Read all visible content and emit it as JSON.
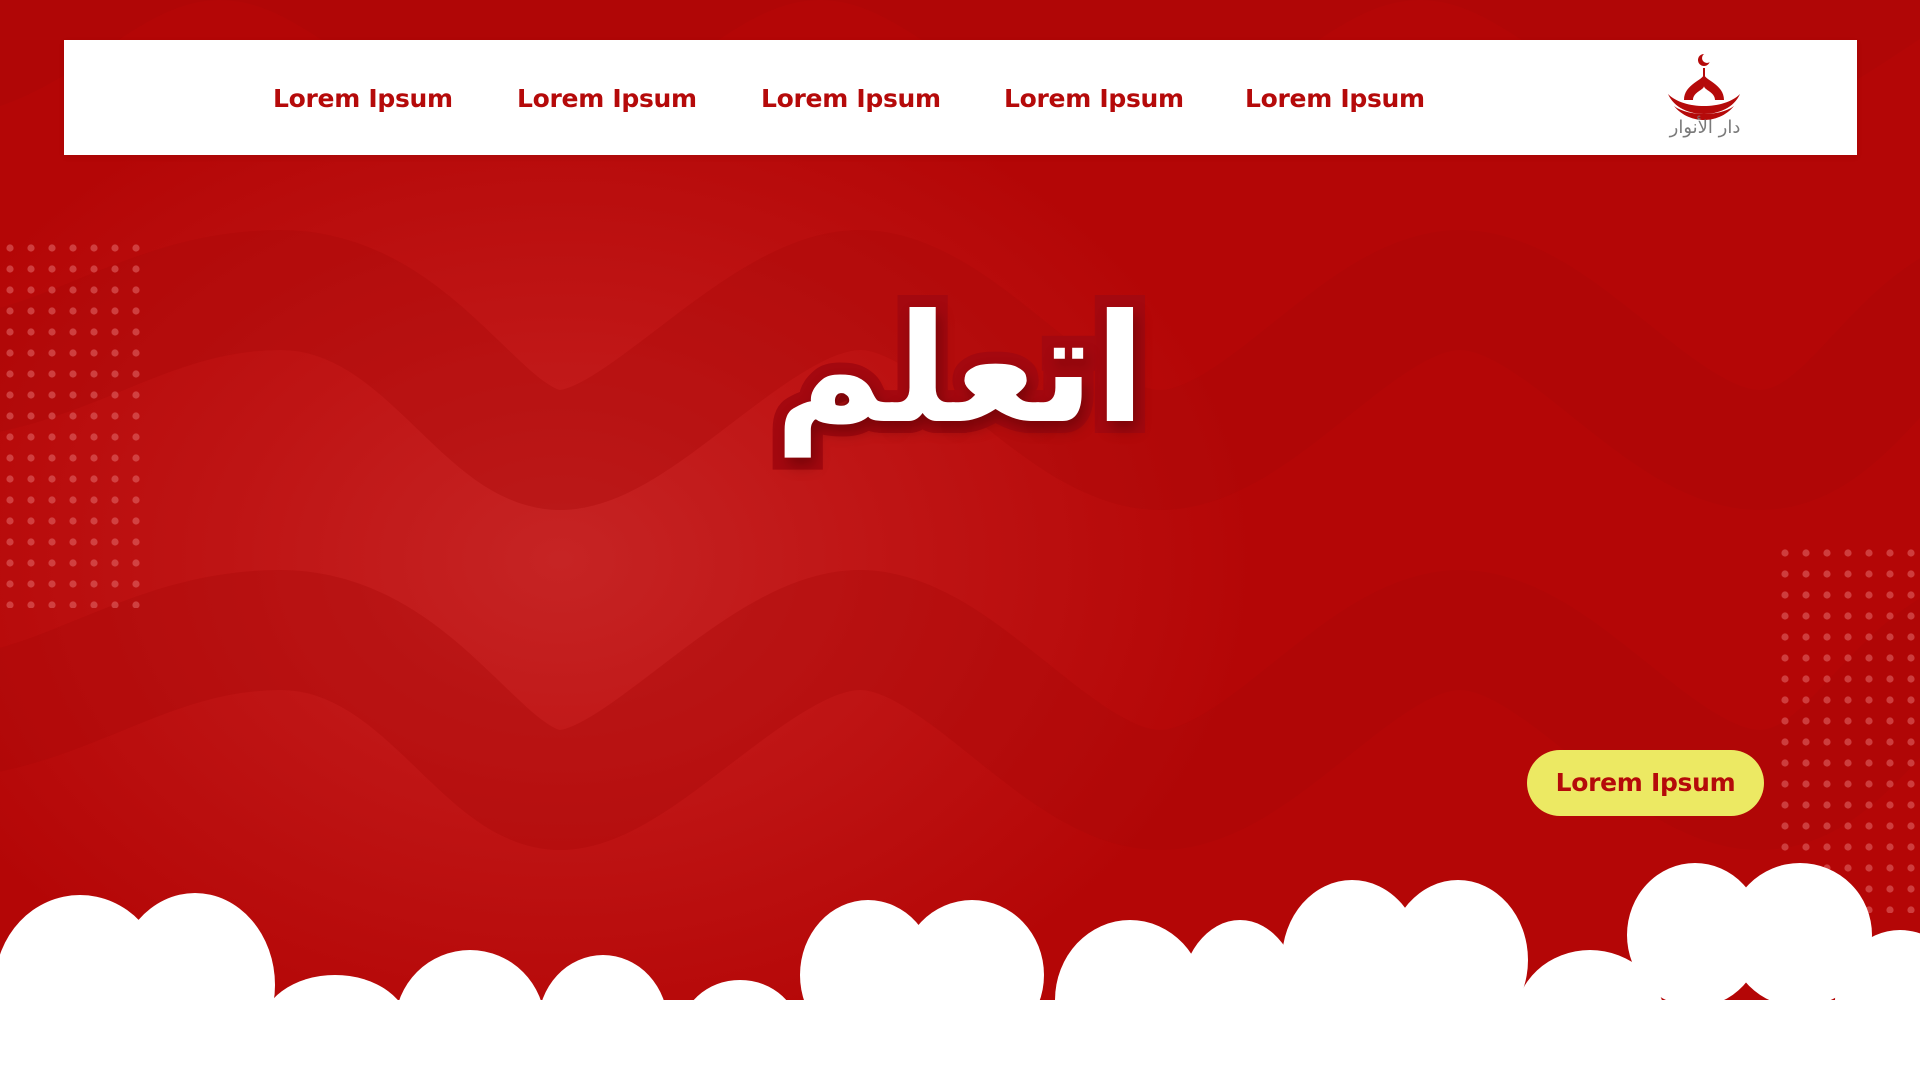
{
  "nav": {
    "items": [
      {
        "label": "Lorem Ipsum"
      },
      {
        "label": "Lorem Ipsum"
      },
      {
        "label": "Lorem Ipsum"
      },
      {
        "label": "Lorem Ipsum"
      },
      {
        "label": "Lorem Ipsum"
      }
    ]
  },
  "logo": {
    "text": "دار الأنوار",
    "icon": "mosque-crescent-icon"
  },
  "hero": {
    "headline": "اتعلم",
    "cta_label": "Lorem Ipsum"
  },
  "colors": {
    "primary": "#b50a0a",
    "accent": "#ece963",
    "navbar": "#ffffff"
  }
}
